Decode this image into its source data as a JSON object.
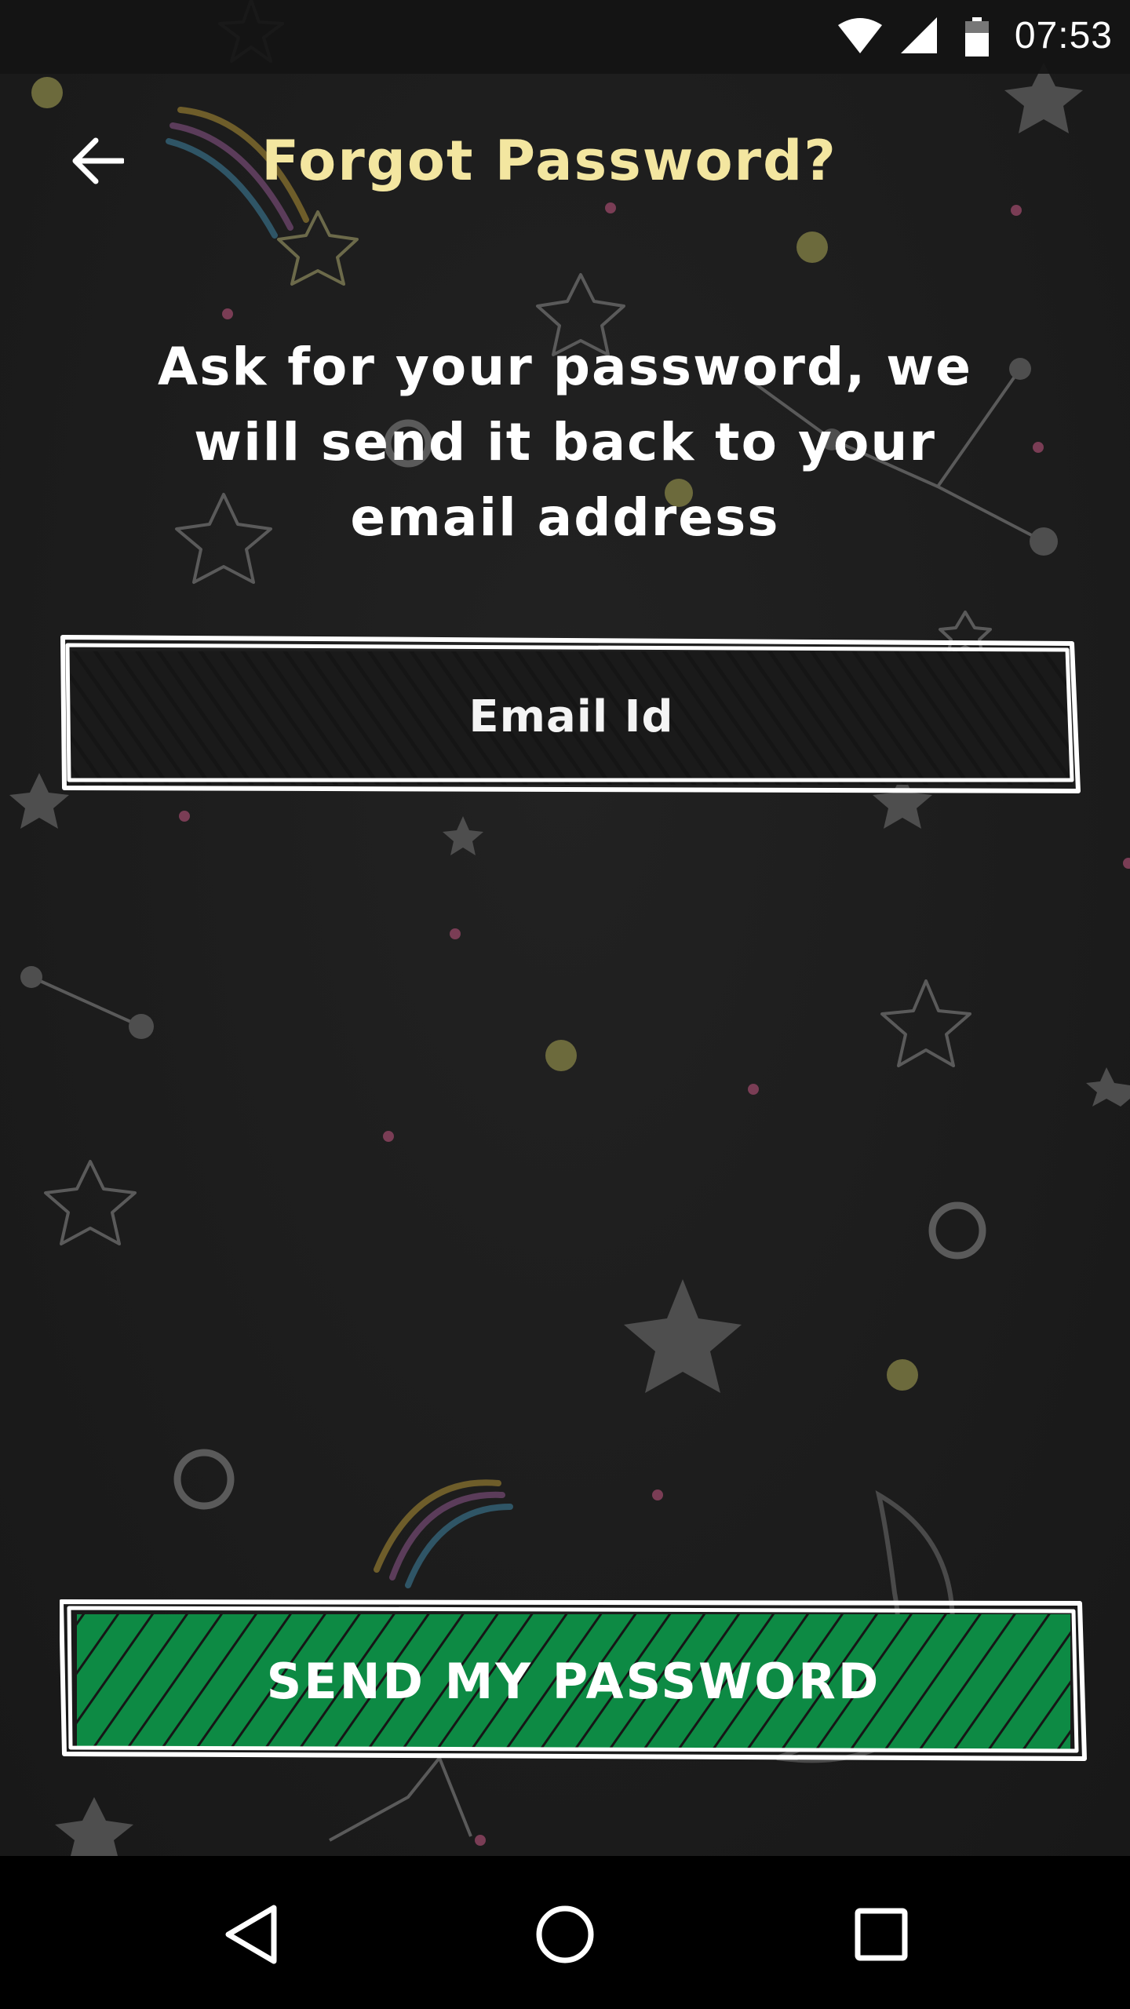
{
  "status_bar": {
    "time": "07:53",
    "icons": [
      "wifi-icon",
      "cellular-signal-icon",
      "battery-icon"
    ]
  },
  "toolbar": {
    "back_icon": "arrow-left-icon",
    "title": "Forgot Password?"
  },
  "instructions": {
    "line1": "Ask for your password, we",
    "line2": "will send it back to your",
    "line3": "email address"
  },
  "email_field": {
    "value": "",
    "placeholder": "Email Id"
  },
  "send_button": {
    "label": "SEND MY PASSWORD"
  },
  "nav_bar": {
    "icons": [
      "back-triangle-icon",
      "home-circle-icon",
      "recents-square-icon"
    ]
  },
  "colors": {
    "background": "#1c1c1c",
    "title": "#f3e6a0",
    "button_green": "#0f8a45",
    "text": "#ffffff"
  }
}
